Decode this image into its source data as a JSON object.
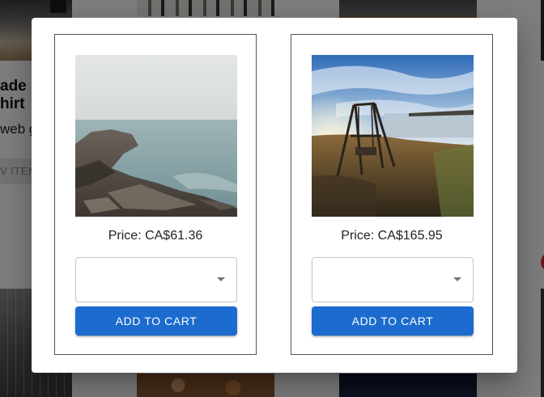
{
  "background": {
    "card_title": "ade\nhirt",
    "card_description": "web g",
    "card_button_label": "V ITEM"
  },
  "dialog": {
    "products": [
      {
        "image_icon": "coast-rocks-image",
        "price_label": "Price: CA$61.36",
        "select_value": "",
        "add_label": "ADD TO CART"
      },
      {
        "image_icon": "swing-seaside-image",
        "price_label": "Price: CA$165.95",
        "select_value": "",
        "add_label": "ADD TO CART"
      }
    ]
  },
  "colors": {
    "primary_button": "#1c6bce",
    "scrim": "rgba(0,0,0,0.5)",
    "select_border": "#c4c4c4"
  }
}
